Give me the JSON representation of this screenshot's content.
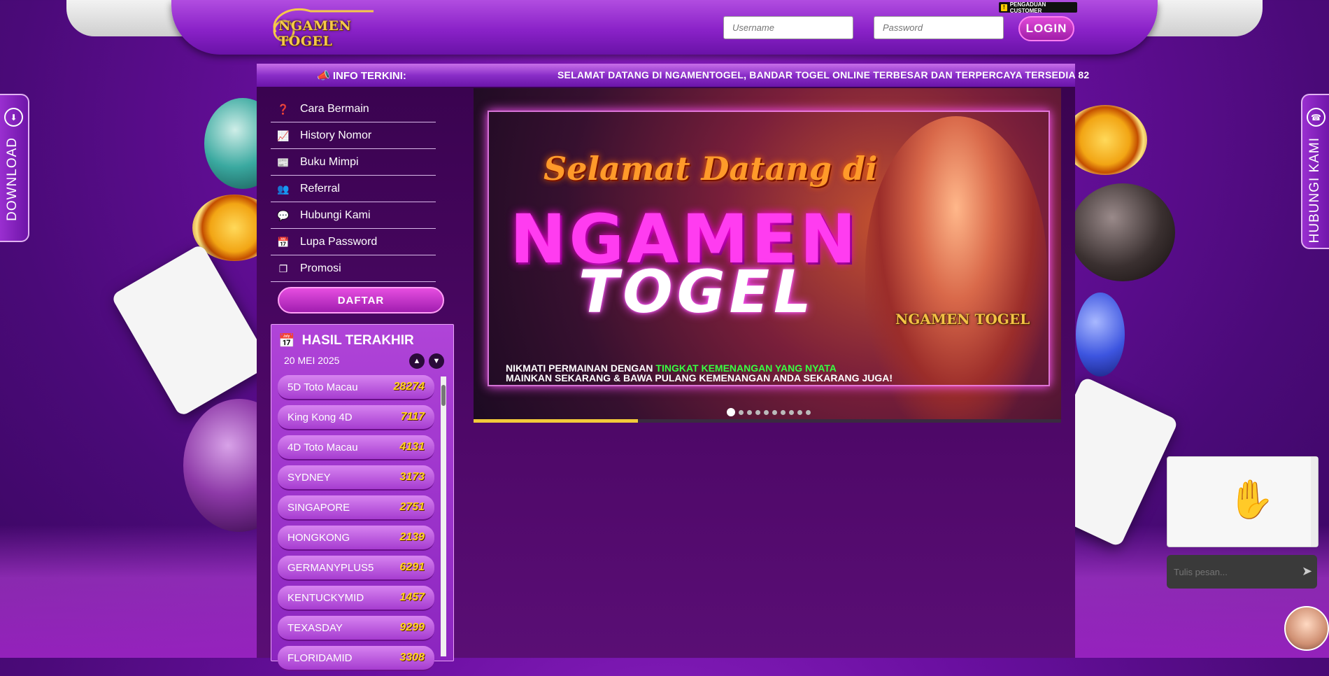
{
  "header": {
    "logo_text": "NGAMEN TOGEL",
    "username_placeholder": "Username",
    "password_placeholder": "Password",
    "login_label": "LOGIN",
    "complaint_label": "PENGADUAN CUSTOMER"
  },
  "marquee": {
    "label": "INFO TERKINI:",
    "text": "SELAMAT DATANG DI NGAMENTOGEL, BANDAR TOGEL ONLINE TERBESAR DAN TERPERCAYA TERSEDIA 82"
  },
  "menu": {
    "items": [
      {
        "label": "Cara Bermain",
        "icon": "question-circle-icon"
      },
      {
        "label": "History Nomor",
        "icon": "line-chart-icon"
      },
      {
        "label": "Buku Mimpi",
        "icon": "book-icon"
      },
      {
        "label": "Referral",
        "icon": "users-icon"
      },
      {
        "label": "Hubungi Kami",
        "icon": "chat-icon"
      },
      {
        "label": "Lupa Password",
        "icon": "calendar-icon"
      },
      {
        "label": "Promosi",
        "icon": "clone-icon"
      }
    ],
    "daftar_label": "DAFTAR"
  },
  "results": {
    "title": "HASIL TERAKHIR",
    "date": "20 MEI 2025",
    "rows": [
      {
        "market": "5D Toto Macau",
        "number": "28274"
      },
      {
        "market": "King Kong 4D",
        "number": "7117"
      },
      {
        "market": "4D Toto Macau",
        "number": "4131"
      },
      {
        "market": "SYDNEY",
        "number": "3173"
      },
      {
        "market": "SINGAPORE",
        "number": "2751"
      },
      {
        "market": "HONGKONG",
        "number": "2139"
      },
      {
        "market": "GERMANYPLUS5",
        "number": "6291"
      },
      {
        "market": "KENTUCKYMID",
        "number": "1457"
      },
      {
        "market": "TEXASDAY",
        "number": "9299"
      },
      {
        "market": "FLORIDAMID",
        "number": "3308"
      }
    ]
  },
  "banner": {
    "welcome": "Selamat Datang di",
    "brand_line1": "NGAMEN",
    "brand_line2": "TOGEL",
    "logo_text": "NGAMEN TOGEL",
    "line1_prefix": "NIKMATI PERMAINAN DENGAN ",
    "line1_highlight": "TINGKAT KEMENANGAN YANG NYATA",
    "line2": "MAINKAN SEKARANG & BAWA PULANG KEMENANGAN ANDA SEKARANG JUGA!",
    "slide_count": 10,
    "active_slide": 1,
    "progress": 0.28
  },
  "side": {
    "download_label": "DOWNLOAD",
    "contact_label": "HUBUNGI KAMI"
  },
  "chat": {
    "placeholder": "Tulis pesan..."
  },
  "colors": {
    "accent": "#a01da8",
    "number_yellow": "#ffd21f",
    "highlight_green": "#39ff42"
  }
}
